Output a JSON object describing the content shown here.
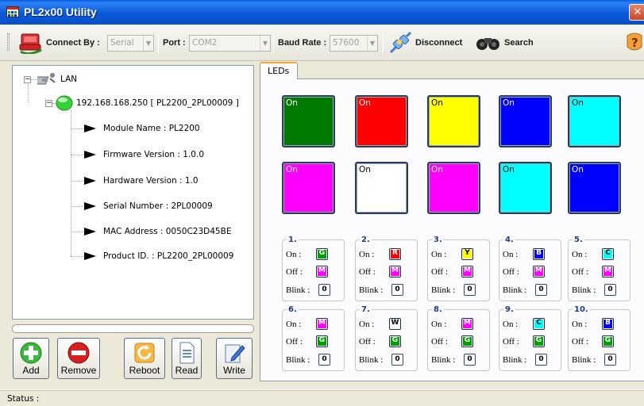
{
  "window": {
    "title": "PL2x00 Utility"
  },
  "toolbar": {
    "connect_by_label": "Connect By :",
    "connect_by_value": "Serial",
    "port_label": "Port :",
    "port_value": "COM2",
    "baud_label": "Baud Rate :",
    "baud_value": "57600",
    "disconnect_label": "Disconnect",
    "search_label": "Search"
  },
  "tree": {
    "root": "LAN",
    "device": "192.168.168.250 [ PL2200_2PL00009 ]",
    "properties": [
      "Module Name : PL2200",
      "Firmware Version : 1.0.0",
      "Hardware Version : 1.0",
      "Serial Number : 2PL00009",
      "MAC Address : 0050C23D45BE",
      "Product ID. : PL2200_2PL00009"
    ]
  },
  "buttons": {
    "add": "Add",
    "remove": "Remove",
    "reboot": "Reboot",
    "read": "Read",
    "write": "Write"
  },
  "tab": {
    "label": "LEDs"
  },
  "leds": [
    {
      "label": "On",
      "color": "#007a00",
      "text_color": "#ffffff"
    },
    {
      "label": "On",
      "color": "#ff0000",
      "text_color": "#ffffff"
    },
    {
      "label": "On",
      "color": "#ffff00",
      "text_color": "#000000"
    },
    {
      "label": "On",
      "color": "#0000ff",
      "text_color": "#ffffff"
    },
    {
      "label": "On",
      "color": "#00ffff",
      "text_color": "#000000"
    },
    {
      "label": "On",
      "color": "#ff00ff",
      "text_color": "#ffffff"
    },
    {
      "label": "On",
      "color": "#ffffff",
      "text_color": "#000000"
    },
    {
      "label": "On",
      "color": "#ff00ff",
      "text_color": "#ffffff"
    },
    {
      "label": "On",
      "color": "#00ffff",
      "text_color": "#000000"
    },
    {
      "label": "On",
      "color": "#0000ff",
      "text_color": "#ffffff"
    }
  ],
  "led_settings_labels": {
    "on": "On :",
    "off": "Off :",
    "blink": "Blink :"
  },
  "led_settings": [
    {
      "num": "1.",
      "on": "G",
      "on_color": "#00a000",
      "off": "M",
      "off_color": "#ff00ff",
      "blink": "0"
    },
    {
      "num": "2.",
      "on": "R",
      "on_color": "#ff0000",
      "off": "M",
      "off_color": "#ff00ff",
      "blink": "0"
    },
    {
      "num": "3.",
      "on": "Y",
      "on_color": "#ffff00",
      "off": "M",
      "off_color": "#ff00ff",
      "blink": "0"
    },
    {
      "num": "4.",
      "on": "B",
      "on_color": "#0000ff",
      "off": "M",
      "off_color": "#ff00ff",
      "blink": "0"
    },
    {
      "num": "5.",
      "on": "C",
      "on_color": "#00ffff",
      "off": "M",
      "off_color": "#ff00ff",
      "blink": "0"
    },
    {
      "num": "6.",
      "on": "M",
      "on_color": "#ff00ff",
      "off": "G",
      "off_color": "#00a000",
      "blink": "0"
    },
    {
      "num": "7.",
      "on": "W",
      "on_color": "#ffffff",
      "off": "G",
      "off_color": "#00a000",
      "blink": "0"
    },
    {
      "num": "8.",
      "on": "M",
      "on_color": "#ff00ff",
      "off": "G",
      "off_color": "#00a000",
      "blink": "0"
    },
    {
      "num": "9.",
      "on": "C",
      "on_color": "#00ffff",
      "off": "G",
      "off_color": "#00a000",
      "blink": "0"
    },
    {
      "num": "10.",
      "on": "B",
      "on_color": "#0000ff",
      "off": "G",
      "off_color": "#00a000",
      "blink": "0"
    }
  ],
  "status": {
    "text": "Status :"
  }
}
